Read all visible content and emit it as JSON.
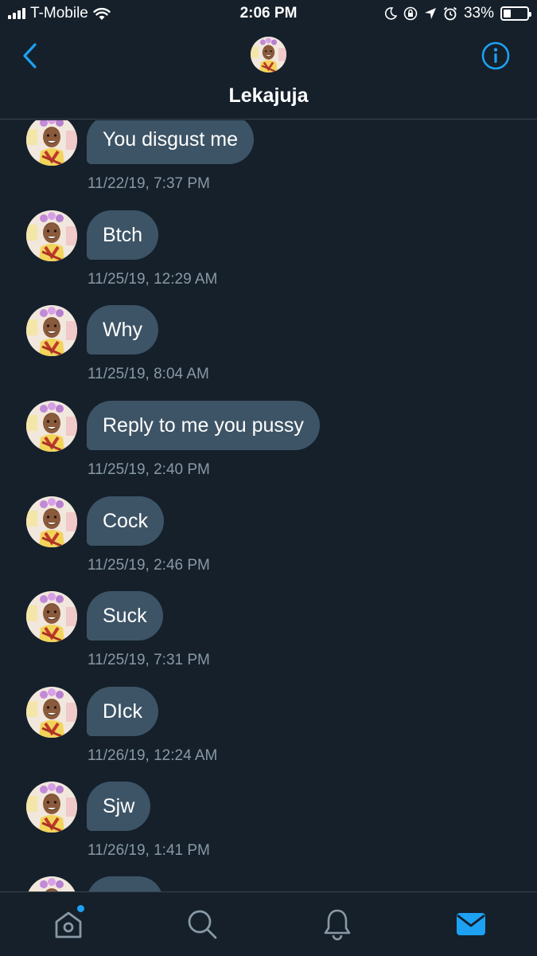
{
  "status_bar": {
    "carrier": "T-Mobile",
    "time": "2:06 PM",
    "battery_text": "33%",
    "battery_level": 0.33
  },
  "header": {
    "title": "Lekajuja"
  },
  "messages": [
    {
      "text": "You disgust me",
      "time": "11/22/19, 7:37 PM"
    },
    {
      "text": "Btch",
      "time": "11/25/19, 12:29 AM"
    },
    {
      "text": "Why",
      "time": "11/25/19, 8:04 AM"
    },
    {
      "text": "Reply to me you pussy",
      "time": "11/25/19, 2:40 PM"
    },
    {
      "text": "Cock",
      "time": "11/25/19, 2:46 PM"
    },
    {
      "text": "Suck",
      "time": "11/25/19, 7:31 PM"
    },
    {
      "text": "DIck",
      "time": "11/26/19, 12:24 AM"
    },
    {
      "text": "Sjw",
      "time": "11/26/19, 1:41 PM"
    },
    {
      "text": "",
      "time": ""
    }
  ],
  "colors": {
    "background": "#15202b",
    "bubble": "#3d5466",
    "accent": "#1da1f2",
    "timestamp": "#8899a6"
  },
  "tabbar": {
    "icons": [
      "home-icon",
      "search-icon",
      "notifications-icon",
      "messages-icon"
    ],
    "active": "messages-icon"
  }
}
